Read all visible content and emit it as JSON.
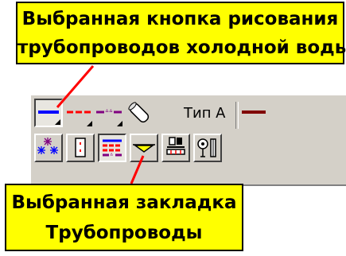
{
  "callouts": {
    "top": {
      "line1": "Выбранная кнопка рисования",
      "line2": "трубопроводов холодной воды"
    },
    "bottom": {
      "line1": "Выбранная закладка",
      "line2": "Трубопроводы"
    }
  },
  "toolbar": {
    "type_label": "Тип А",
    "row1_icons": [
      "cold-water-pipe-icon",
      "red-dashed-pipe-icon",
      "purple-marked-pipe-icon",
      "pipe-insulation-icon",
      "dark-red-pipe-icon"
    ],
    "row2_icons": [
      "sprinkler-icon",
      "outlet-box-icon",
      "pipelines-tab-icon",
      "valve-icon",
      "equipment-icon",
      "fitting-icon"
    ]
  },
  "colors": {
    "callout_background": "#ffff00",
    "pointer": "#ff0000",
    "toolbar_background": "#d4d0c8",
    "cold_water": "#0000ff",
    "hot_water": "#ff0000",
    "marked_pipe": "#800080",
    "dark_red_pipe": "#800000"
  }
}
